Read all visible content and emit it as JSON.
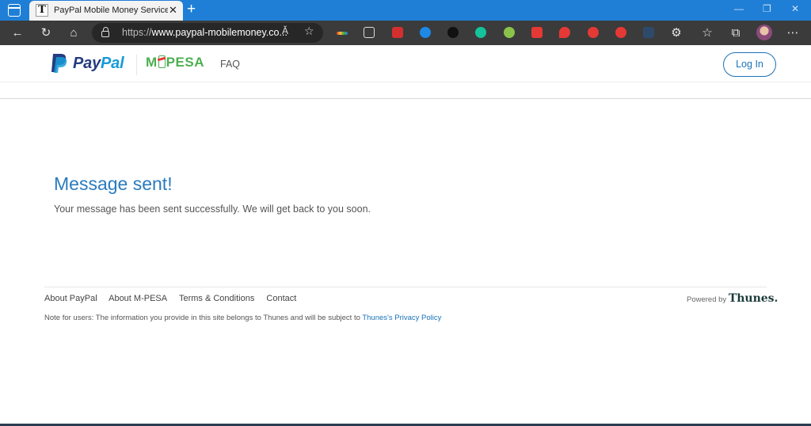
{
  "browser": {
    "tab_title": "PayPal Mobile Money Service wit",
    "tab_favicon": "T",
    "url_prefix": "https://",
    "url_host": "www.paypal-mobilemoney.co...",
    "read_aloud": "Ă",
    "icons": [
      "sidebar-icon",
      "back-icon",
      "refresh-icon",
      "home-icon",
      "lock-icon",
      "favorites-icon",
      "collections-icon",
      "settings-more-icon",
      "extensions-icon"
    ]
  },
  "header": {
    "paypal_pay": "Pay",
    "paypal_pal": "Pal",
    "mpesa_m": "M",
    "mpesa_rest": "PESA",
    "faq_label": "FAQ",
    "login_label": "Log In"
  },
  "main": {
    "title": "Message sent!",
    "text": "Your message has been sent successfully. We will get back to you soon."
  },
  "footer": {
    "links": [
      "About PayPal",
      "About M-PESA",
      "Terms & Conditions",
      "Contact"
    ],
    "powered_by": "Powered by",
    "powered_brand": "Thunes.",
    "note": "Note for users: The information you provide in this site belongs to Thunes and will be subject to ",
    "privacy_link": "Thunes's Privacy Policy"
  },
  "colors": {
    "tab_bar": "#1f7fd6",
    "paypal_dark": "#253b80",
    "paypal_light": "#179bd7",
    "mpesa_green": "#4caf50",
    "accent": "#2a7bbf"
  }
}
